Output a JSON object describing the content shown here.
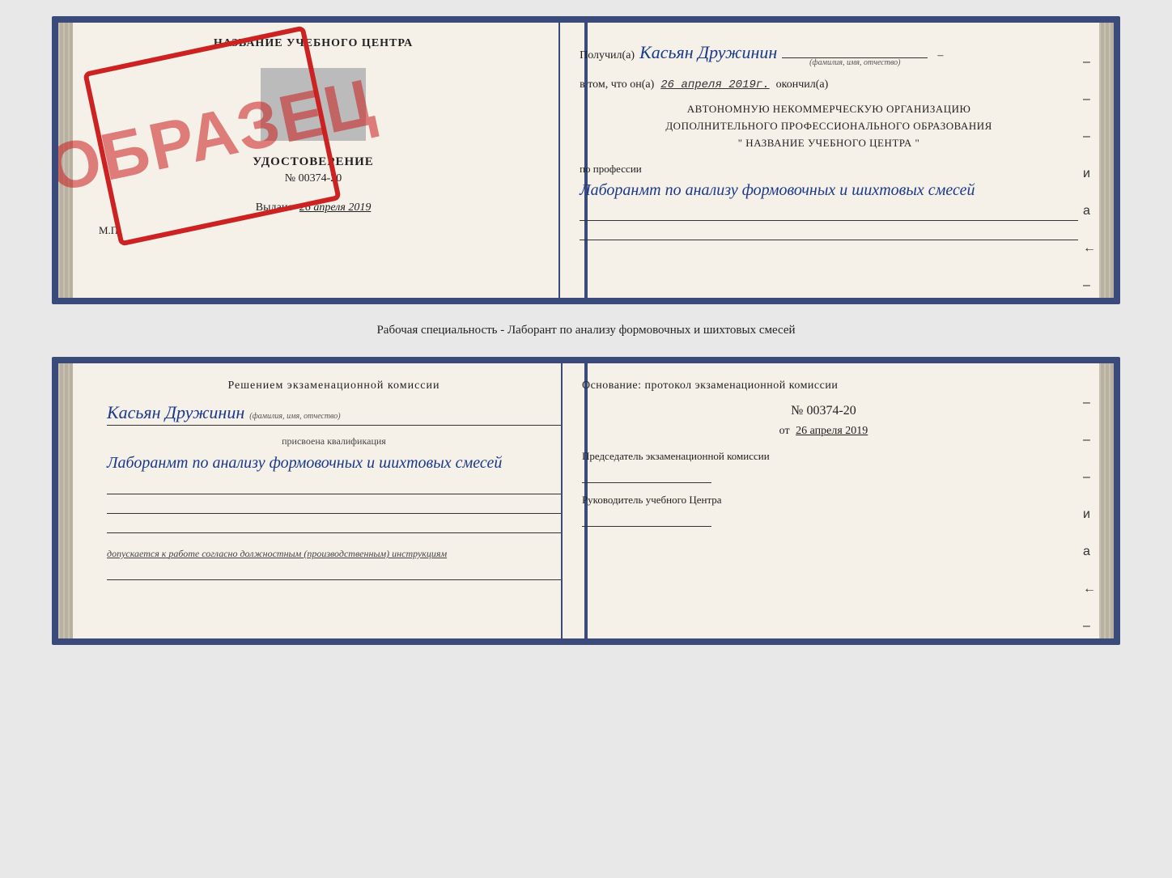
{
  "top_doc": {
    "left": {
      "school_name": "НАЗВАНИЕ УЧЕБНОГО ЦЕНТРА",
      "udostoverenie_label": "УДОСТОВЕРЕНИЕ",
      "number": "№ 00374-20",
      "vydano_label": "Выдано",
      "vydano_date": "26 апреля 2019",
      "mp": "М.П.",
      "stamp_text": "ОБРАЗЕЦ"
    },
    "right": {
      "poluchil_label": "Получил(a)",
      "recipient_name": "Касьян Дружинин",
      "fio_hint": "(фамилия, имя, отчество)",
      "vtom_label": "в том, что он(а)",
      "completed_date": "26 апреля 2019г.",
      "okonchil_label": "окончил(а)",
      "org_line1": "АВТОНОМНУЮ НЕКОММЕРЧЕСКУЮ ОРГАНИЗАЦИЮ",
      "org_line2": "ДОПОЛНИТЕЛЬНОГО ПРОФЕССИОНАЛЬНОГО ОБРАЗОВАНИЯ",
      "org_line3": "\" НАЗВАНИЕ УЧЕБНОГО ЦЕНТРА \"",
      "po_professii_label": "по профессии",
      "profession_handwritten": "Лаборанмт по анализу формовочных и шихтовых смесей",
      "bars": [
        "-",
        "-",
        "-",
        "и",
        "а",
        "←",
        "-",
        "-"
      ]
    }
  },
  "specialty_line": "Рабочая специальность - Лаборант по анализу формовочных и шихтовых смесей",
  "bottom_doc": {
    "left": {
      "resheniyem_label": "Решением экзаменационной комиссии",
      "name_handwritten": "Касьян Дружинин",
      "fio_hint": "(фамилия, имя, отчество)",
      "prisvoena_label": "присвоена квалификация",
      "qualification_handwritten": "Лаборанмт по анализу формовочных и шихтовых смесей",
      "dopuskaetsya_label": "допускается к",
      "dopuskaetsya_text": "работе согласно должностным (производственным) инструкциям"
    },
    "right": {
      "osnovanie_label": "Основание: протокол экзаменационной комиссии",
      "protokol_number": "№ 00374-20",
      "ot_label": "от",
      "ot_date": "26 апреля 2019",
      "predsedatel_label": "Председатель экзаменационной комиссии",
      "rukovoditel_label": "Руководитель учебного Центра",
      "bars": [
        "-",
        "-",
        "-",
        "и",
        "а",
        "←",
        "-",
        "-"
      ]
    }
  }
}
